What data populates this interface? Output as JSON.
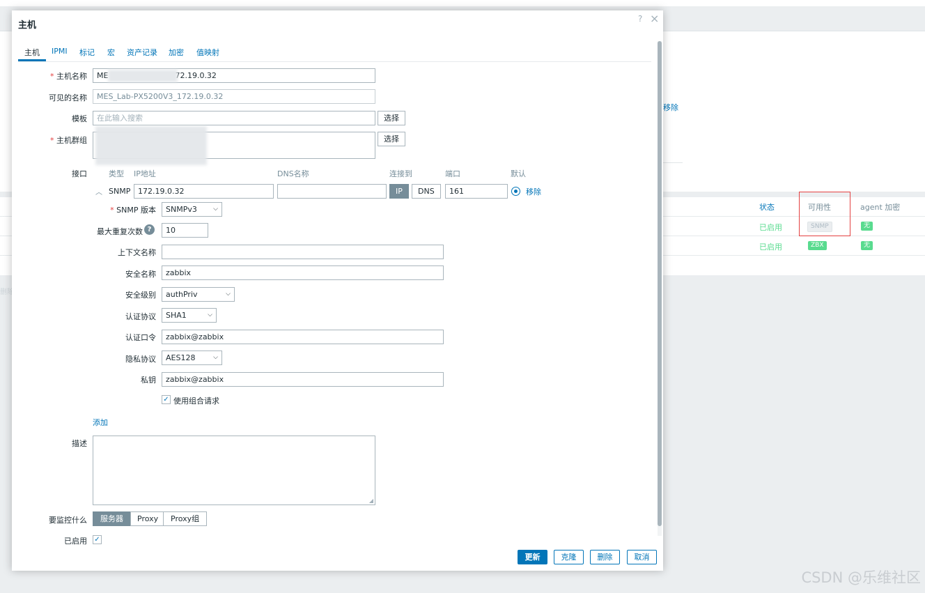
{
  "background": {
    "link_remove": "移除",
    "table_headers": {
      "status": "状态",
      "availability": "可用性",
      "agent_encryption": "agent 加密"
    },
    "rows": [
      {
        "status": "已启用",
        "availability": "SNMP",
        "encryption": "无"
      },
      {
        "status": "已启用",
        "availability": "ZBX",
        "encryption": "无"
      }
    ],
    "faded_left": "删除",
    "watermark": "CSDN @乐维社区"
  },
  "dialog": {
    "title": "主机",
    "help": "?",
    "close": "×",
    "tabs": [
      "主机",
      "IPMI",
      "标记",
      "宏",
      "资产记录",
      "加密",
      "值映射"
    ],
    "form": {
      "host_name_label": "主机名称",
      "host_name_value_prefix": "ME",
      "host_name_value_suffix": "72.19.0.32",
      "visible_name_label": "可见的名称",
      "visible_name_value": "MES_Lab-PX5200V3_172.19.0.32",
      "templates_label": "模板",
      "templates_placeholder": "在此输入搜索",
      "select_button": "选择",
      "host_groups_label": "主机群组",
      "interfaces_label": "接口",
      "iface_columns": {
        "type": "类型",
        "ip": "IP地址",
        "dns": "DNS名称",
        "connect": "连接到",
        "port": "端口",
        "default": "默认"
      },
      "iface": {
        "type": "SNMP",
        "ip": "172.19.0.32",
        "dns": "",
        "connect_ip": "IP",
        "connect_dns": "DNS",
        "port": "161",
        "remove": "移除"
      },
      "snmp_version_label": "SNMP 版本",
      "snmp_version": "SNMPv3",
      "max_repetitions_label": "最大重复次数",
      "max_repetitions": "10",
      "context_name_label": "上下文名称",
      "context_name": "",
      "security_name_label": "安全名称",
      "security_name": "zabbix",
      "security_level_label": "安全级别",
      "security_level": "authPriv",
      "auth_protocol_label": "认证协议",
      "auth_protocol": "SHA1",
      "auth_passphrase_label": "认证口令",
      "auth_passphrase": "zabbix@zabbix",
      "priv_protocol_label": "隐私协议",
      "priv_protocol": "AES128",
      "priv_passphrase_label": "私钥",
      "priv_passphrase": "zabbix@zabbix",
      "bulk_label": "使用组合请求",
      "add_link": "添加",
      "description_label": "描述",
      "monitored_by_label": "要监控什么",
      "monitored_by": [
        "服务器",
        "Proxy",
        "Proxy组"
      ],
      "enabled_label": "已启用"
    },
    "footer": {
      "update": "更新",
      "clone": "克隆",
      "delete": "删除",
      "cancel": "取消"
    }
  }
}
